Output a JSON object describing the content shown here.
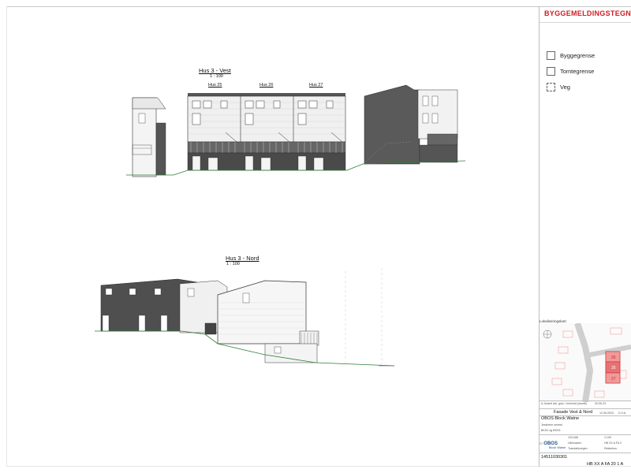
{
  "sheet": {
    "header_title": "BYGGEMELDINGSTEGNIN",
    "legend": [
      {
        "label": "Byggegrense",
        "style": "solid"
      },
      {
        "label": "Tomtegrense",
        "style": "solid"
      },
      {
        "label": "Veg",
        "style": "dashed"
      }
    ]
  },
  "views": {
    "vest": {
      "title": "Hus 3 - Vest",
      "scale": "1 : 100",
      "units": [
        "Hus 25",
        "Hus 26",
        "Hus 27"
      ]
    },
    "nord": {
      "title": "Hus 3 - Nord",
      "scale": "1 : 100"
    }
  },
  "location_map": {
    "title": "Lokaliseringskart",
    "units": [
      "25",
      "26",
      "27"
    ]
  },
  "title_block": {
    "revision_note": "A    Justert ark, gulv, i henhold (utsnitt)",
    "revision_date": "20.05.23",
    "drawing_title": "Fasade Vest & Nord",
    "drawing_date": "12.05.2023",
    "drawn_by": "D.V.A.",
    "company": "OBOS Block Watne",
    "project": "Jessheim senest",
    "phase": "BKS2 og BKS3",
    "gnr_bnr": "131/168",
    "scale": "1:100",
    "municipality": "Ullensaker",
    "address": "Trandakkvegen",
    "drawing_code_short": "HB XX A FA 2",
    "building_type": "Rekkehus",
    "logo_text": "OBOS",
    "logo_sub": "Block Watne",
    "project_number": "14511030301",
    "drawing_number": "HB XX A FA 20 1 A"
  }
}
